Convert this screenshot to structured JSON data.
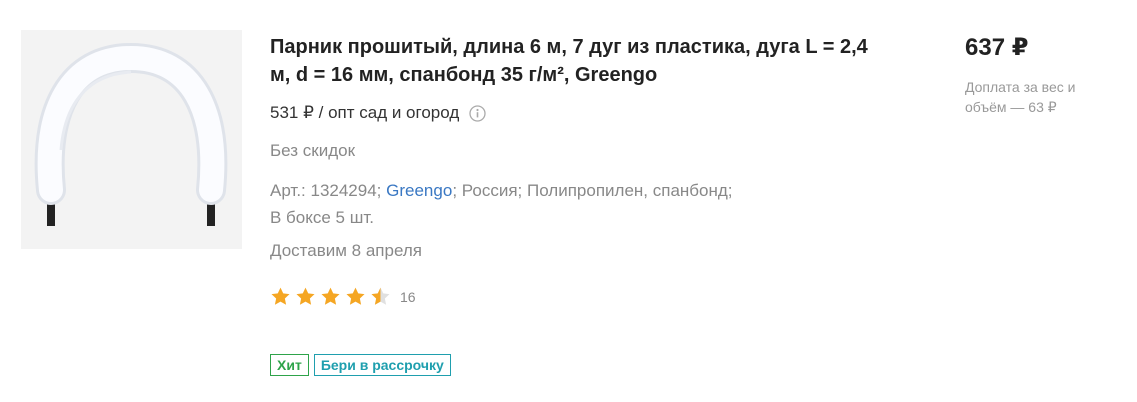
{
  "product": {
    "title": "Парник прошитый, длина 6 м, 7 дуг из пластика, дуга L = 2,4 м, d = 16 мм, спанбонд 35 г/м², Greengo",
    "wholesale_price": "531 ₽ / опт сад и огород",
    "discount_text": "Без скидок",
    "specs": {
      "article": "Арт.: 1324294;",
      "brand_link": "Greengo",
      "brand_suffix": ";",
      "country": "Россия;",
      "material": "Полипропилен, спанбонд;",
      "box_qty": "В боксе 5 шт."
    },
    "delivery": "Доставим 8 апреля",
    "rating": {
      "value": 4.5,
      "max": 5,
      "review_count": "16",
      "star_color": "#f5a623"
    },
    "badges": {
      "hit": "Хит",
      "installment": "Бери в рассрочку"
    },
    "price": "637 ₽",
    "surcharge": "Доплата за вес и объём — 63 ₽",
    "icons": {
      "info": "info-circle-icon",
      "star": "star-icon"
    }
  }
}
